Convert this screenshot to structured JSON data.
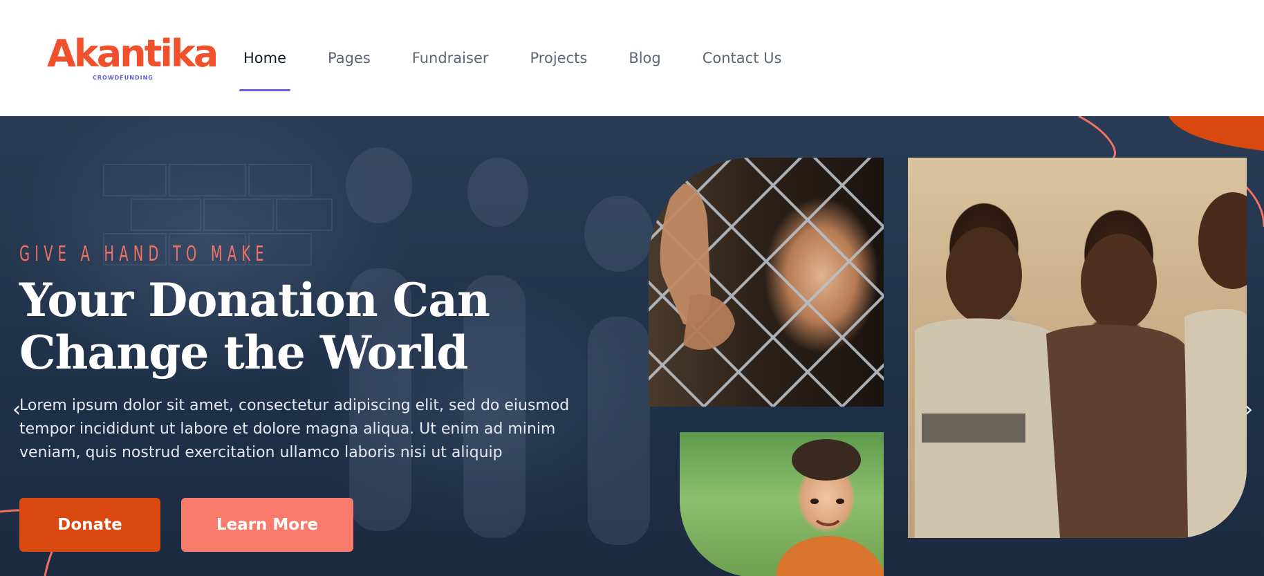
{
  "brand": {
    "name": "Akantika",
    "tagline": "CROWDFUNDING",
    "color": "#f0512c"
  },
  "nav": {
    "items": [
      {
        "label": "Home",
        "active": true
      },
      {
        "label": "Pages",
        "active": false
      },
      {
        "label": "Fundraiser",
        "active": false
      },
      {
        "label": "Projects",
        "active": false
      },
      {
        "label": "Blog",
        "active": false
      },
      {
        "label": "Contact Us",
        "active": false
      }
    ],
    "active_indicator_color": "#6c5ce7"
  },
  "hero": {
    "eyebrow": "GIVE A HAND TO MAKE",
    "title": "Your Donation Can Change the World",
    "description": "Lorem ipsum dolor sit amet, consectetur adipiscing elit, sed do eiusmod tempor incididunt ut labore et dolore magna aliqua. Ut enim ad minim veniam, quis nostrud exercitation ullamco laboris nisi ut aliquip",
    "buttons": {
      "donate": "Donate",
      "learn_more": "Learn More"
    },
    "arrows": {
      "prev_icon": "chevron-left-icon",
      "next_icon": "chevron-right-icon"
    },
    "colors": {
      "background": "#1f3049",
      "eyebrow": "#f07263",
      "donate": "#d9480f",
      "learn_more": "#f87b6c"
    }
  }
}
